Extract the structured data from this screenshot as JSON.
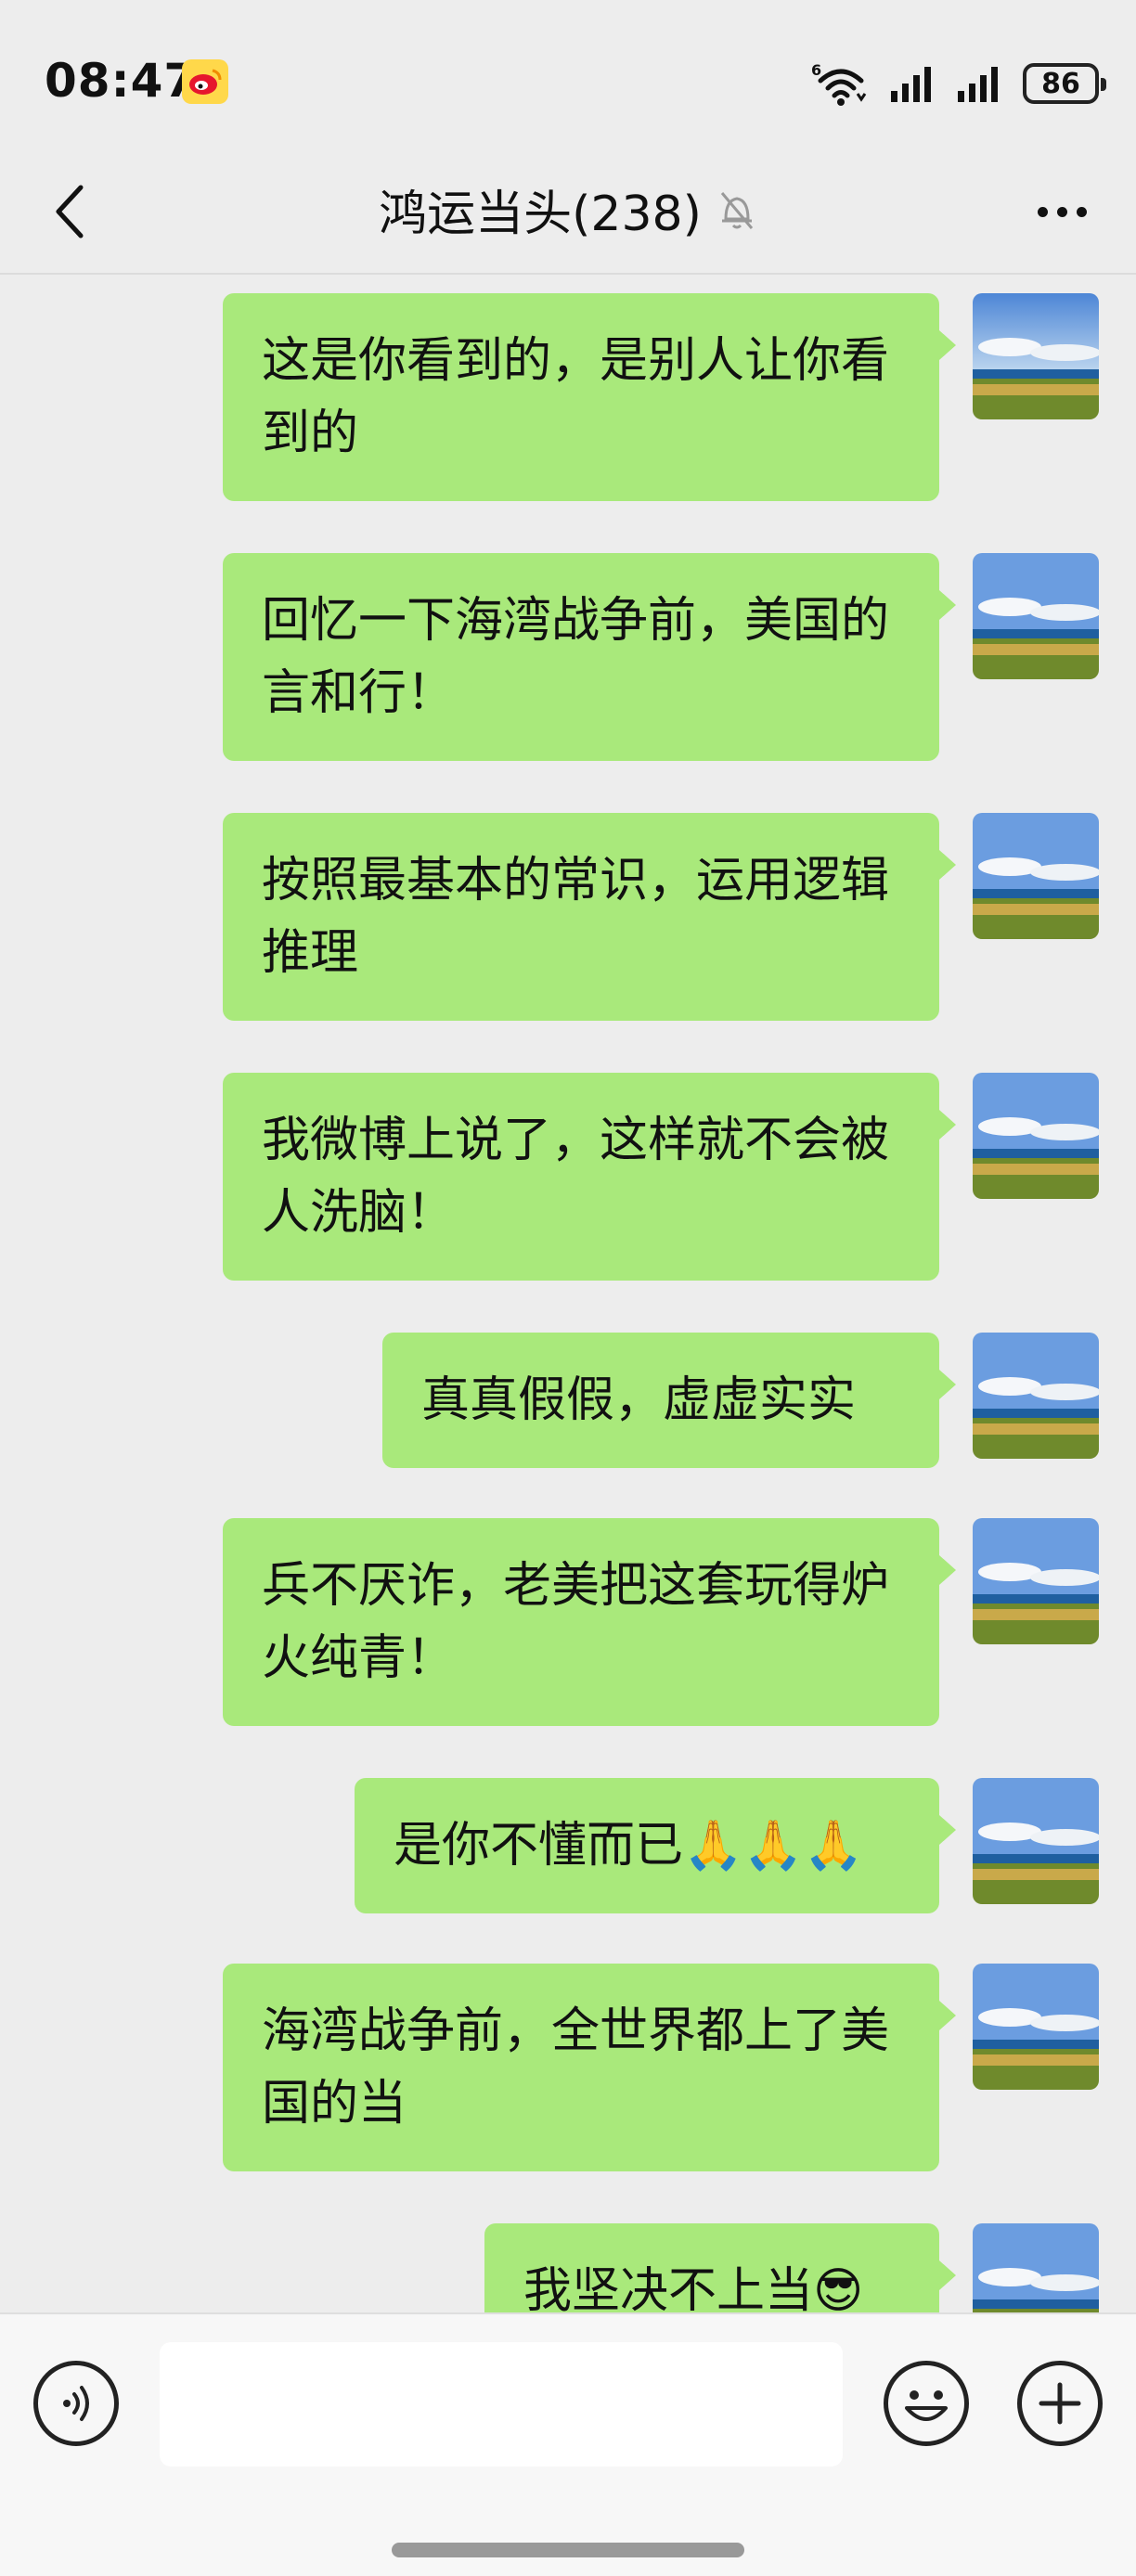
{
  "status_bar": {
    "time": "08:47",
    "battery": "86",
    "network_badge": "6"
  },
  "header": {
    "title": "鸿运当头(238)",
    "muted_icon": "bell-off-icon"
  },
  "messages": [
    {
      "text": "这是你看到的，是别人让你看到的"
    },
    {
      "text": "回忆一下海湾战争前，美国的言和行！"
    },
    {
      "text": "按照最基本的常识，运用逻辑推理"
    },
    {
      "text": "我微博上说了，这样就不会被人洗脑！"
    },
    {
      "text": "真真假假，虚虚实实"
    },
    {
      "text": "兵不厌诈，老美把这套玩得炉火纯青！"
    },
    {
      "text": "是你不懂而已🙏🙏🙏"
    },
    {
      "text": "海湾战争前，全世界都上了美国的当"
    },
    {
      "text": "我坚决不上当😎"
    }
  ],
  "input_bar": {
    "placeholder": "",
    "icons": [
      "voice-icon",
      "emoji-icon",
      "plus-icon"
    ]
  }
}
